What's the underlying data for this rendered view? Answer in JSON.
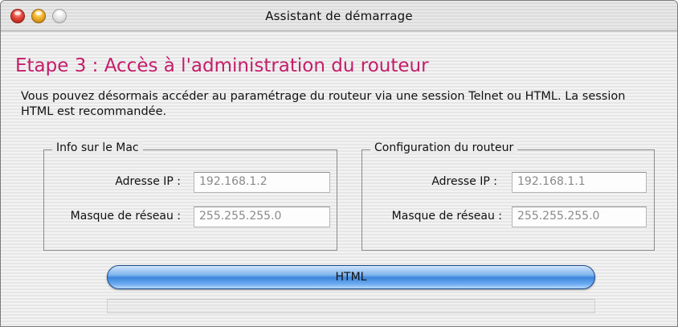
{
  "window": {
    "title": "Assistant de démarrage"
  },
  "step": {
    "heading": "Etape 3 : Accès à l'administration du routeur",
    "description": "Vous pouvez désormais accéder au paramétrage du routeur via une session Telnet ou HTML. La session HTML est recommandée."
  },
  "mac_info": {
    "title": "Info sur le Mac",
    "ip_label": "Adresse IP :",
    "ip_value": "192.168.1.2",
    "mask_label": "Masque de réseau :",
    "mask_value": "255.255.255.0"
  },
  "router_config": {
    "title": "Configuration du routeur",
    "ip_label": "Adresse IP :",
    "ip_value": "192.168.1.1",
    "mask_label": "Masque de réseau :",
    "mask_value": "255.255.255.0"
  },
  "actions": {
    "html_button": "HTML"
  },
  "colors": {
    "heading": "#c41d6a",
    "button": "#3d86dc"
  }
}
